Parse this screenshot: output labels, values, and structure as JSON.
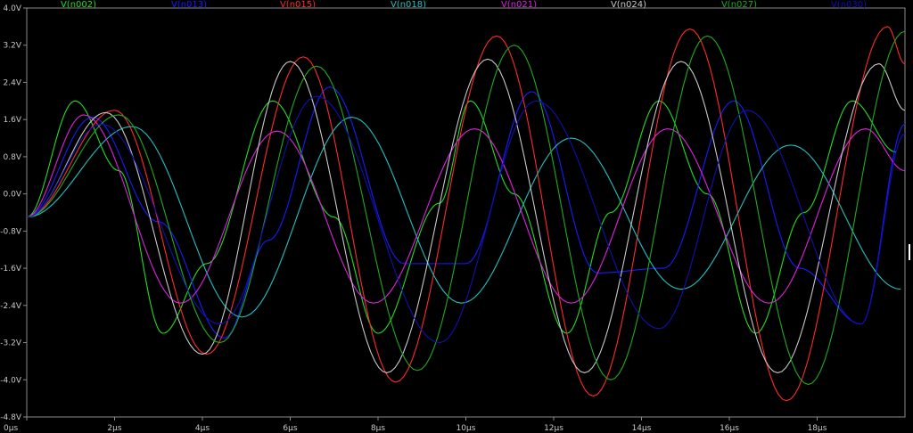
{
  "chart_data": {
    "type": "line",
    "xlim": [
      0,
      20
    ],
    "x_unit": "µs",
    "ylim": [
      -4.8,
      4.0
    ],
    "y_unit": "V",
    "grid": false,
    "legend_position": "top",
    "x_ticks": [
      "0µs",
      "2µs",
      "4µs",
      "6µs",
      "8µs",
      "10µs",
      "12µs",
      "14µs",
      "16µs",
      "18µs"
    ],
    "y_ticks": [
      "4.0V",
      "3.2V",
      "2.4V",
      "1.6V",
      "0.8V",
      "0.0V",
      "-0.8V",
      "-1.6V",
      "-2.4V",
      "-3.2V",
      "-4.0V",
      "-4.8V"
    ],
    "series": [
      {
        "name": "V(n002)",
        "color": "#22dd22",
        "x": [
          0,
          1.1,
          2.1,
          3.1,
          4.1,
          5.6,
          7.0,
          8.0,
          9.4,
          10.1,
          11.1,
          12.3,
          13.3,
          14.4,
          15.5,
          16.6,
          17.7,
          18.8,
          19.8
        ],
        "y": [
          -0.5,
          2.0,
          0.5,
          -3.0,
          -1.5,
          2.0,
          -0.5,
          -3.0,
          -0.2,
          2.0,
          0.0,
          -3.0,
          -0.4,
          2.0,
          0.0,
          -3.0,
          -0.4,
          2.0,
          0.9
        ]
      },
      {
        "name": "V(n013)",
        "color": "#1a1aff",
        "x": [
          0,
          1.5,
          3.0,
          4.5,
          5.5,
          6.9,
          8.6,
          10.0,
          11.5,
          13.0,
          14.5,
          16.1,
          17.6,
          19.0,
          20.0
        ],
        "y": [
          -0.5,
          1.65,
          -0.6,
          -3.1,
          -1.0,
          2.3,
          -1.5,
          -1.5,
          2.2,
          -1.7,
          -1.6,
          2.0,
          -1.6,
          -2.8,
          1.5
        ]
      },
      {
        "name": "V(n015)",
        "color": "#ff2a2a",
        "x": [
          0,
          2.0,
          4.1,
          6.3,
          8.4,
          10.7,
          12.9,
          15.1,
          17.3,
          19.6,
          20.0
        ],
        "y": [
          -0.5,
          1.8,
          -3.45,
          2.95,
          -4.05,
          3.4,
          -4.35,
          3.55,
          -4.45,
          3.6,
          2.8
        ]
      },
      {
        "name": "V(n018)",
        "color": "#22c0c0",
        "x": [
          0,
          2.4,
          4.9,
          7.4,
          9.9,
          12.4,
          14.9,
          17.4,
          19.9
        ],
        "y": [
          -0.5,
          1.45,
          -2.65,
          1.65,
          -2.35,
          1.2,
          -2.05,
          1.05,
          -2.05
        ]
      },
      {
        "name": "V(n021)",
        "color": "#e020e0",
        "x": [
          0,
          1.3,
          3.5,
          5.7,
          7.9,
          10.2,
          12.4,
          14.6,
          16.9,
          19.1,
          20.0
        ],
        "y": [
          -0.5,
          1.7,
          -2.35,
          1.35,
          -2.35,
          1.4,
          -2.35,
          1.4,
          -2.35,
          1.4,
          0.5
        ]
      },
      {
        "name": "V(n024)",
        "color": "#c8c8c8",
        "x": [
          0,
          1.8,
          4.0,
          6.0,
          8.2,
          10.5,
          12.7,
          14.9,
          17.1,
          19.4,
          20.0
        ],
        "y": [
          -0.5,
          1.75,
          -3.45,
          2.85,
          -3.85,
          2.9,
          -3.85,
          2.85,
          -3.85,
          2.8,
          1.8
        ]
      },
      {
        "name": "V(n027)",
        "color": "#1faa1f",
        "x": [
          0,
          2.1,
          4.4,
          6.6,
          8.9,
          11.1,
          13.3,
          15.5,
          17.8,
          20.0
        ],
        "y": [
          -0.5,
          1.7,
          -3.2,
          2.75,
          -3.8,
          3.2,
          -4.0,
          3.4,
          -4.1,
          3.5
        ]
      },
      {
        "name": "V(n030)",
        "color": "#1010b0",
        "x": [
          0,
          1.7,
          4.4,
          6.6,
          9.4,
          11.6,
          14.4,
          16.4,
          19.0,
          20.0
        ],
        "y": [
          -0.5,
          1.5,
          -2.8,
          2.1,
          -3.2,
          2.0,
          -2.9,
          1.8,
          -2.8,
          1.3
        ]
      }
    ]
  }
}
